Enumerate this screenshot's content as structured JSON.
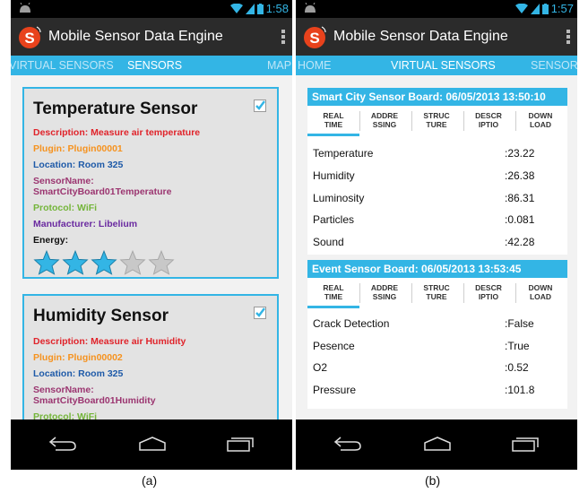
{
  "app": {
    "title": "Mobile Sensor Data Engine"
  },
  "phone_a": {
    "status_time": "1:58",
    "tabs": [
      "VIRTUAL SENSORS",
      "SENSORS",
      "MAP"
    ],
    "sensors": [
      {
        "name": "Temperature Sensor",
        "checked": true,
        "description": "Description:  Measure air temperature",
        "plugin": "Plugin: Plugin00001",
        "location": "Location: Room 325",
        "sensorname_label": "SensorName:",
        "sensorname_value": "SmartCityBoard01Temperature",
        "protocol": "Protocol: WiFi",
        "manufacturer": "Manufacturer: Libelium",
        "energy_label": "Energy:",
        "energy_rating": 3,
        "energy_max": 5
      },
      {
        "name": "Humidity Sensor",
        "checked": true,
        "description": "Description:  Measure air Humidity",
        "plugin": "Plugin: Plugin00002",
        "location": "Location: Room 325",
        "sensorname_label": "SensorName:",
        "sensorname_value": "SmartCityBoard01Humidity",
        "protocol": "Protocol: WiFi"
      }
    ]
  },
  "phone_b": {
    "status_time": "1:57",
    "tabs": [
      "HOME",
      "VIRTUAL SENSORS",
      "SENSORS"
    ],
    "board_tabs": [
      [
        "REAL",
        "TIME"
      ],
      [
        "ADDRE",
        "SSING"
      ],
      [
        "STRUC",
        "TURE"
      ],
      [
        "DESCR",
        "IPTIO"
      ],
      [
        "DOWN",
        "LOAD"
      ]
    ],
    "boards": [
      {
        "title": "Smart City Sensor Board: 06/05/2013 13:50:10",
        "rows": [
          {
            "label": "Temperature",
            "value": ":23.22"
          },
          {
            "label": "Humidity",
            "value": ":26.38"
          },
          {
            "label": "Luminosity",
            "value": ":86.31"
          },
          {
            "label": "Particles",
            "value": ":0.081"
          },
          {
            "label": "Sound",
            "value": ":42.28"
          }
        ]
      },
      {
        "title": "Event Sensor Board: 06/05/2013 13:53:45",
        "rows": [
          {
            "label": "Crack Detection",
            "value": ":False"
          },
          {
            "label": "Pesence",
            "value": ":True"
          },
          {
            "label": "O2",
            "value": ":0.52"
          },
          {
            "label": "Pressure",
            "value": ":101.8"
          }
        ]
      }
    ]
  },
  "captions": [
    "(a)",
    "(b)"
  ],
  "colors": {
    "accent": "#33b5e5",
    "actionbar": "#2b2b2b",
    "logo": "#e8421c"
  }
}
